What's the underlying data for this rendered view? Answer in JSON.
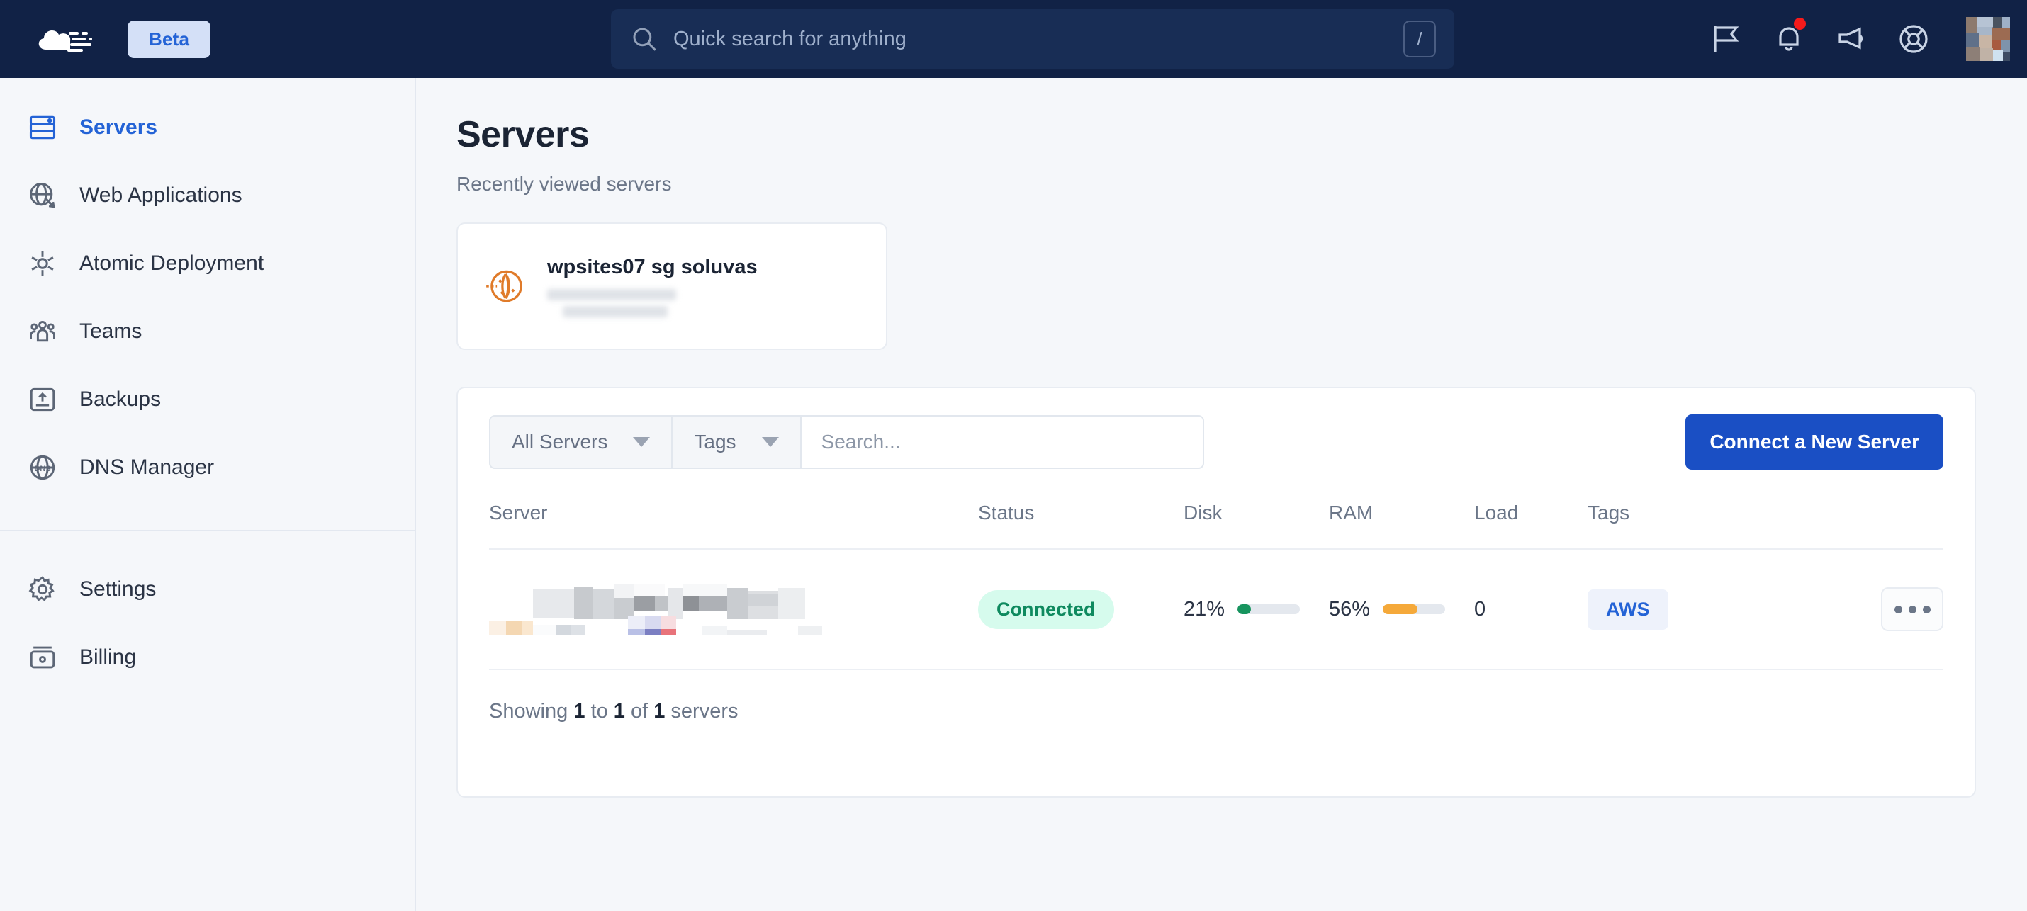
{
  "topbar": {
    "logo_icon": "cloud-logo-icon",
    "beta_label": "Beta",
    "search": {
      "placeholder": "Quick search for anything",
      "value": "",
      "icon": "search-icon",
      "shortcut_key": "/"
    },
    "icons": [
      {
        "name": "flag-icon",
        "has_badge": false
      },
      {
        "name": "bell-icon",
        "has_badge": true
      },
      {
        "name": "megaphone-icon",
        "has_badge": false
      },
      {
        "name": "lifebuoy-support-icon",
        "has_badge": false
      }
    ],
    "avatar": "user-avatar",
    "background_color": "#112246",
    "notification_dot_color": "#f61b1b"
  },
  "sidebar": {
    "primary_items": [
      {
        "label": "Servers",
        "icon": "server-icon",
        "active": true
      },
      {
        "label": "Web Applications",
        "icon": "globe-cursor-icon",
        "active": false
      },
      {
        "label": "Atomic Deployment",
        "icon": "atom-icon",
        "active": false
      },
      {
        "label": "Teams",
        "icon": "teams-icon",
        "active": false
      },
      {
        "label": "Backups",
        "icon": "backup-upload-icon",
        "active": false
      },
      {
        "label": "DNS Manager",
        "icon": "dns-globe-icon",
        "active": false
      }
    ],
    "secondary_items": [
      {
        "label": "Settings",
        "icon": "gear-icon",
        "active": false
      },
      {
        "label": "Billing",
        "icon": "wallet-icon",
        "active": false
      }
    ],
    "active_color": "#2463d6"
  },
  "main": {
    "title": "Servers",
    "subtitle": "Recently viewed servers",
    "recent_card": {
      "provider_icon": "cloud-provider-orange-icon",
      "name": "wpsites07 sg soluvas",
      "detail_redacted": true
    },
    "toolbar": {
      "filter_label": "All Servers",
      "tags_label": "Tags",
      "search_placeholder": "Search...",
      "search_value": "",
      "connect_button": "Connect a New Server",
      "connect_button_color": "#1a4fc4"
    },
    "table": {
      "columns": [
        "Server",
        "Status",
        "Disk",
        "RAM",
        "Load",
        "Tags"
      ],
      "rows": [
        {
          "server_redacted": true,
          "status": "Connected",
          "status_color": "#0f8a5f",
          "status_bg": "#d6fbed",
          "disk": "21%",
          "disk_percent": 21,
          "disk_bar_color": "#17945e",
          "ram": "56%",
          "ram_percent": 56,
          "ram_bar_color": "#f6a githubb33"
        }
      ]
    },
    "footer": {
      "showing_prefix": "Showing",
      "from": "1",
      "to_word": "to",
      "to": "1",
      "of_word": "of",
      "total": "1",
      "suffix": "servers"
    }
  },
  "row_values": {
    "disk": "21%",
    "ram": "56%",
    "load": "0",
    "tag": "AWS",
    "status": "Connected"
  }
}
